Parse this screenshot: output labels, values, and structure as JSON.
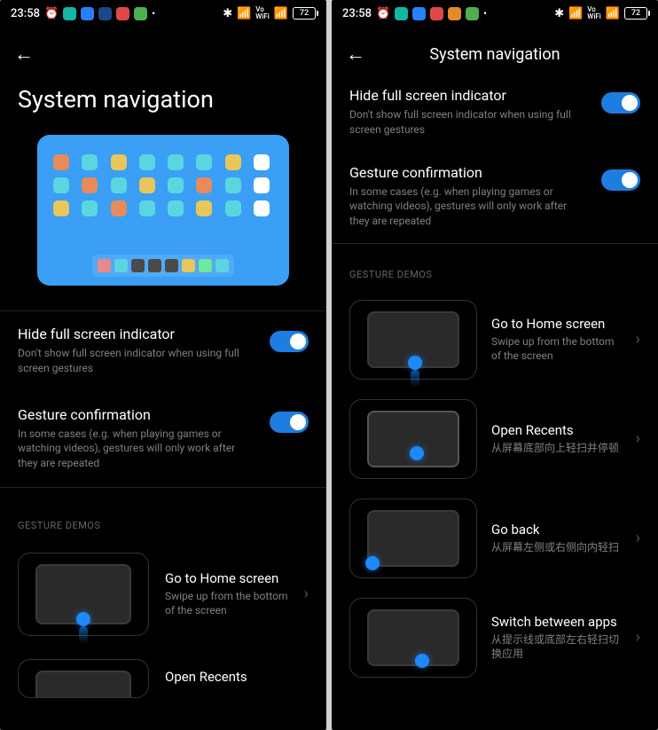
{
  "statusbar": {
    "time": "23:58",
    "battery": "72"
  },
  "left": {
    "page_title": "System navigation",
    "settings": {
      "hide_indicator": {
        "title": "Hide full screen indicator",
        "desc": "Don't show full screen indicator when using full screen gestures"
      },
      "gesture_conf": {
        "title": "Gesture confirmation",
        "desc": "In some cases (e.g. when playing games or watching videos), gestures will only work after they are repeated"
      }
    },
    "section_label": "GESTURE DEMOS",
    "demos": {
      "home": {
        "title": "Go to Home screen",
        "desc": "Swipe up from the bottom of the screen"
      },
      "recents": {
        "title": "Open Recents"
      }
    }
  },
  "right": {
    "page_title": "System navigation",
    "settings": {
      "hide_indicator": {
        "title": "Hide full screen indicator",
        "desc": "Don't show full screen indicator when using full screen gestures"
      },
      "gesture_conf": {
        "title": "Gesture confirmation",
        "desc": "In some cases (e.g. when playing games or watching videos), gestures will only work after they are repeated"
      }
    },
    "section_label": "GESTURE DEMOS",
    "demos": {
      "home": {
        "title": "Go to Home screen",
        "desc": "Swipe up from the bottom of the screen"
      },
      "recents": {
        "title": "Open Recents",
        "desc": "从屏幕底部向上轻扫并停顿"
      },
      "back": {
        "title": "Go back",
        "desc": "从屏幕左侧或右侧向内轻扫"
      },
      "switch": {
        "title": "Switch between apps",
        "desc": "从提示线或底部左右轻扫切换应用"
      }
    }
  },
  "preview_colors": {
    "row1": [
      "#e88a5a",
      "#5ad6e0",
      "#e8c65a",
      "#5ad6e0",
      "#5ad6e0",
      "#5ad6e0",
      "#e8c65a",
      "#ffffff"
    ],
    "row2": [
      "#5ad6e0",
      "#e88a5a",
      "#5ad6e0",
      "#e8c65a",
      "#5ad6e0",
      "#e88a5a",
      "#5ad6e0",
      "#ffffff"
    ],
    "row3": [
      "#e8c65a",
      "#5ad6e0",
      "#e88a5a",
      "#5ad6e0",
      "#5ad6e0",
      "#e8c65a",
      "#5ad6e0",
      "#ffffff"
    ],
    "dock": [
      "#e88a8a",
      "#5ad6e0",
      "#4a4a4a",
      "#4a4a4a",
      "#4a4a4a",
      "#e8c65a",
      "#6ee89a",
      "#5ad6e0"
    ]
  }
}
